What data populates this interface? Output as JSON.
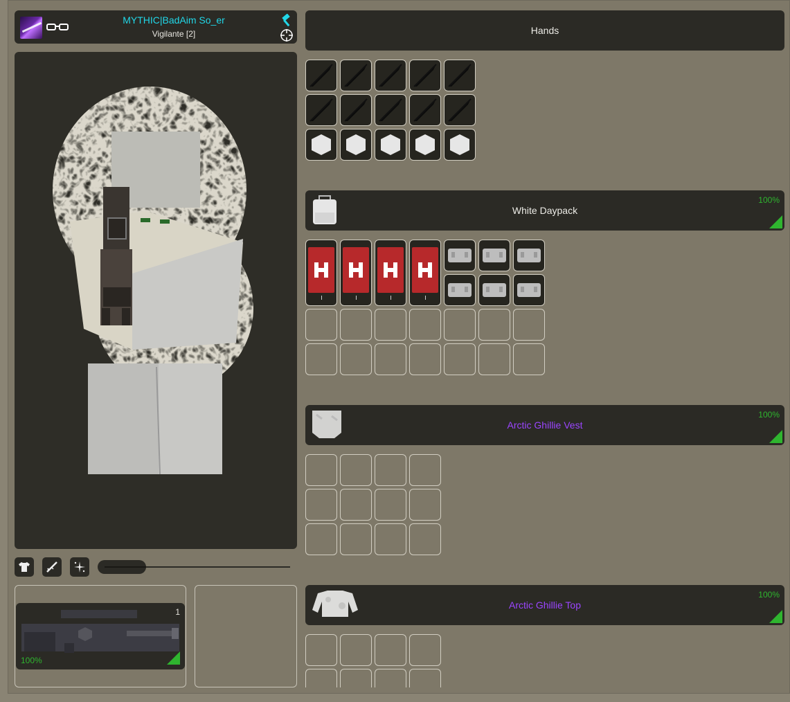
{
  "player": {
    "name": "MYTHIC|BadAim So_er",
    "group": "Vigilante [2]",
    "name_color": "#21d7e8"
  },
  "icons": {
    "avatar": "purple-avatar",
    "glasses": "glasses-icon",
    "hammer": "hammer-icon",
    "target": "crosshair-icon",
    "clothing_tab": "shirt-icon",
    "weapon_tab": "rifle-icon",
    "effects_tab": "sparkle-icon"
  },
  "hands": {
    "title": "Hands",
    "rows": [
      [
        "knife",
        "knife",
        "knife",
        "knife",
        "knife"
      ],
      [
        "knife",
        "knife",
        "knife",
        "knife",
        "knife"
      ],
      [
        "hex",
        "hex",
        "hex",
        "hex",
        "hex"
      ]
    ]
  },
  "daypack": {
    "title": "White Daypack",
    "quality": "100%",
    "columns": 7,
    "rows": 4,
    "items": [
      "bandage",
      "bandage",
      "bandage",
      "bandage",
      "small-pack",
      "small-pack",
      "small-pack",
      "small-pack",
      "small-pack",
      "small-pack"
    ]
  },
  "vest": {
    "title": "Arctic Ghillie Vest",
    "quality": "100%",
    "rarity_color": "#9b45ff",
    "columns": 4,
    "rows": 3
  },
  "top": {
    "title": "Arctic Ghillie Top",
    "quality": "100%",
    "rarity_color": "#9b45ff",
    "columns": 4,
    "rows": 2
  },
  "primary_weapon": {
    "count": "1",
    "quality": "100%"
  },
  "colors": {
    "quality_green": "#2fb52f",
    "panel_dark": "#2b2a25",
    "background": "#7e7868"
  }
}
